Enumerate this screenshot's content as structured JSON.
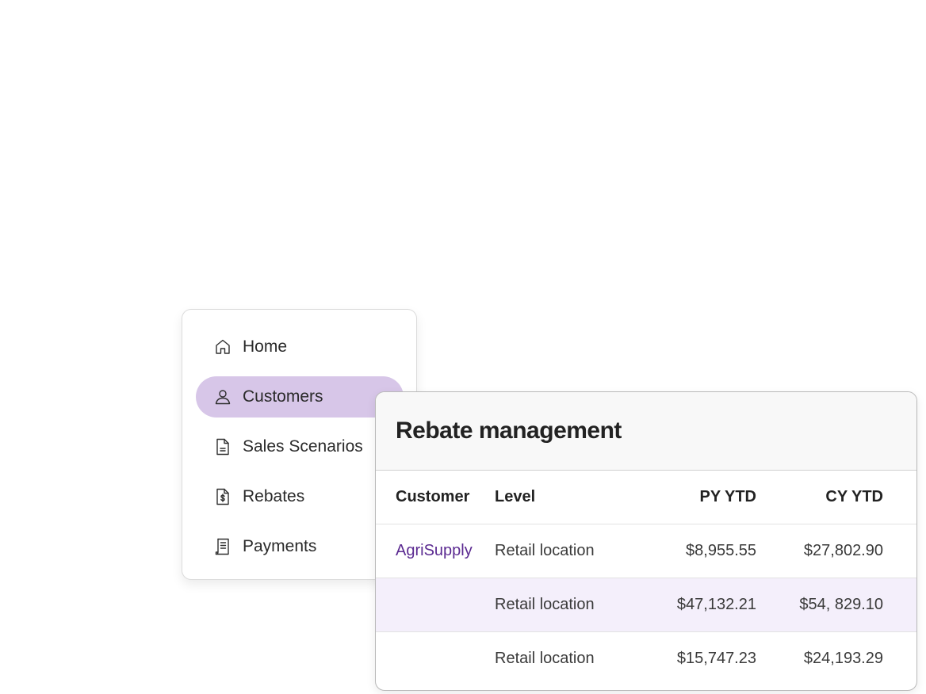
{
  "nav": {
    "items": [
      {
        "label": "Home",
        "icon": "home-icon",
        "active": false
      },
      {
        "label": "Customers",
        "icon": "user-icon",
        "active": true
      },
      {
        "label": "Sales Scenarios",
        "icon": "document-icon",
        "active": false
      },
      {
        "label": "Rebates",
        "icon": "dollar-document-icon",
        "active": false
      },
      {
        "label": "Payments",
        "icon": "receipt-icon",
        "active": false
      }
    ],
    "active_color": "#d7c6e8"
  },
  "rebate_panel": {
    "title": "Rebate management",
    "columns": [
      "Customer",
      "Level",
      "PY YTD",
      "CY YTD"
    ],
    "rows": [
      {
        "customer": "AgriSupply",
        "level": "Retail location",
        "py_ytd": "$8,955.55",
        "cy_ytd": "$27,802.90"
      },
      {
        "customer": "",
        "level": "Retail location",
        "py_ytd": "$47,132.21",
        "cy_ytd": "$54, 829.10"
      },
      {
        "customer": "",
        "level": "Retail location",
        "py_ytd": "$15,747.23",
        "cy_ytd": "$24,193.29"
      }
    ],
    "link_color": "#5b2a91",
    "highlight_row_color": "#f4effb"
  }
}
